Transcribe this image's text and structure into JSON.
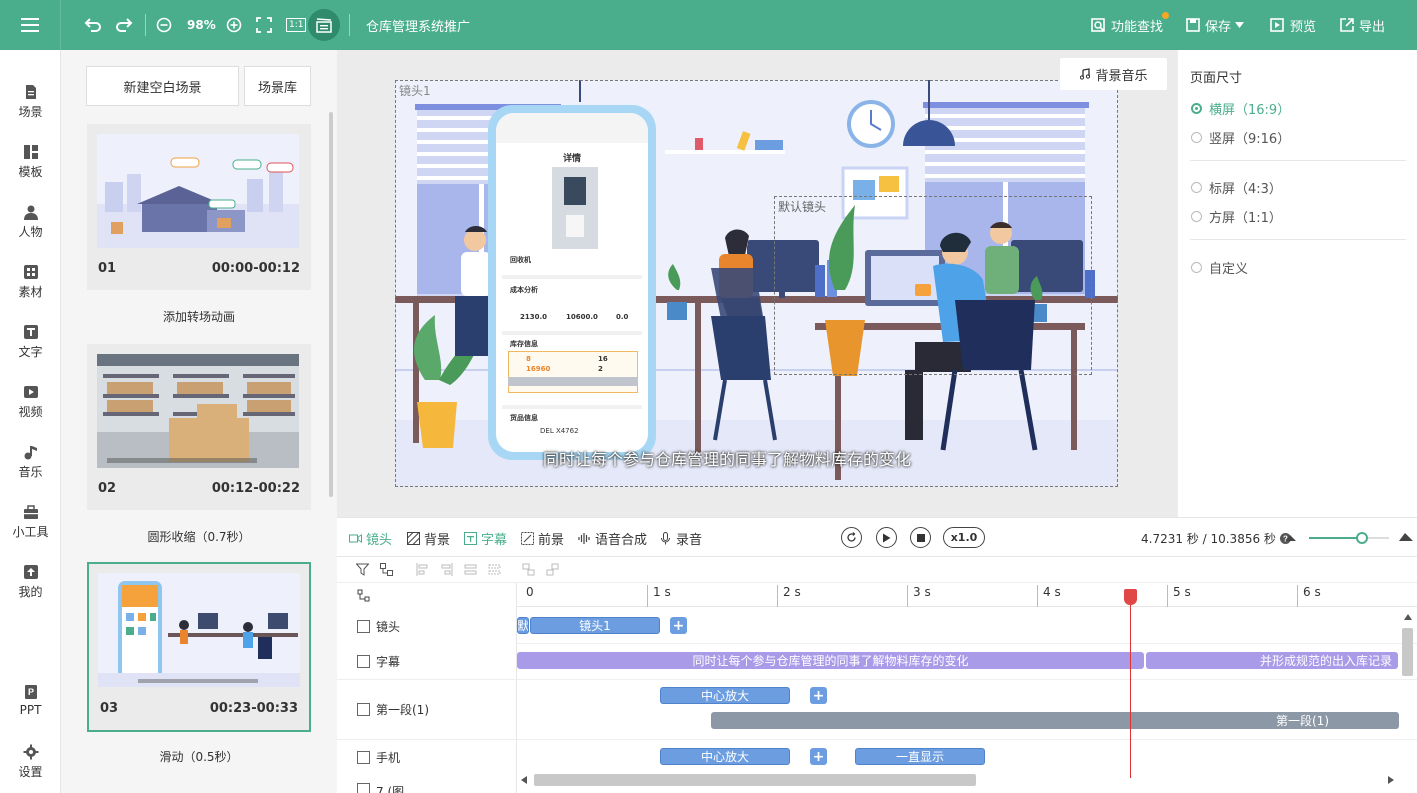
{
  "toolbar": {
    "zoom": "98%",
    "project_title": "仓库管理系统推广",
    "find_label": "功能查找",
    "save_label": "保存",
    "preview_label": "预览",
    "export_label": "导出",
    "ratio_label": "1:1"
  },
  "nav": {
    "items": [
      {
        "label": "场景",
        "icon": "scene-icon"
      },
      {
        "label": "模板",
        "icon": "template-icon"
      },
      {
        "label": "人物",
        "icon": "person-icon"
      },
      {
        "label": "素材",
        "icon": "material-icon"
      },
      {
        "label": "文字",
        "icon": "text-icon"
      },
      {
        "label": "视频",
        "icon": "video-icon"
      },
      {
        "label": "音乐",
        "icon": "music-icon"
      },
      {
        "label": "小工具",
        "icon": "toolbox-icon"
      },
      {
        "label": "我的",
        "icon": "upload-icon"
      }
    ],
    "ppt_label": "PPT",
    "settings_label": "设置"
  },
  "scenes": {
    "new_blank_label": "新建空白场景",
    "library_label": "场景库",
    "items": [
      {
        "num": "01",
        "time": "00:00-00:12",
        "transition": "添加转场动画"
      },
      {
        "num": "02",
        "time": "00:12-00:22",
        "transition": "圆形收缩（0.7秒）"
      },
      {
        "num": "03",
        "time": "00:23-00:33",
        "transition": "滑动（0.5秒）"
      }
    ]
  },
  "canvas": {
    "bgm_label": "背景音乐",
    "shot1_label": "镜头1",
    "default_shot_label": "默认镜头",
    "subtitle": "同时让每个参与仓库管理的同事了解物料库存的变化",
    "phone": {
      "title": "详情",
      "product": "回收机",
      "cost_title": "成本分析",
      "cost_values": [
        "2130.0",
        "10600.0",
        "0.0"
      ],
      "stock_title": "库存信息",
      "stock_a": "8",
      "stock_b": "16",
      "stock_c": "16960",
      "stock_d": "2",
      "cargo_title": "货品信息",
      "cargo_code": "DEL X4762"
    }
  },
  "page_size": {
    "title": "页面尺寸",
    "options": [
      {
        "label": "横屏（16:9）",
        "selected": true
      },
      {
        "label": "竖屏（9:16）",
        "selected": false
      },
      {
        "label": "标屏（4:3）",
        "selected": false
      },
      {
        "label": "方屏（1:1）",
        "selected": false
      },
      {
        "label": "自定义",
        "selected": false
      }
    ]
  },
  "timeline": {
    "tabs": [
      "镜头",
      "背景",
      "字幕",
      "前景",
      "语音合成",
      "录音"
    ],
    "speed": "x1.0",
    "time": "4.7231 秒 / 10.3856 秒",
    "ruler": [
      "0",
      "1 s",
      "2 s",
      "3 s",
      "4 s",
      "5 s",
      "6 s"
    ],
    "tracks": {
      "shot": "镜头",
      "subtitle": "字幕",
      "segment": "第一段(1)",
      "phone": "手机",
      "next": "7 (图"
    },
    "clips": {
      "shot_default": "默",
      "shot1": "镜头1",
      "sub1": "同时让每个参与仓库管理的同事了解物料库存的变化",
      "sub2": "并形成规范的出入库记录",
      "zoom_in": "中心放大",
      "segment": "第一段(1)",
      "zoom_in2": "中心放大",
      "always": "一直显示"
    }
  },
  "colors": {
    "brand": "#4aae8c",
    "clip_blue": "#6c9de0",
    "clip_purple": "#a99be8",
    "playhead": "#e04848"
  }
}
